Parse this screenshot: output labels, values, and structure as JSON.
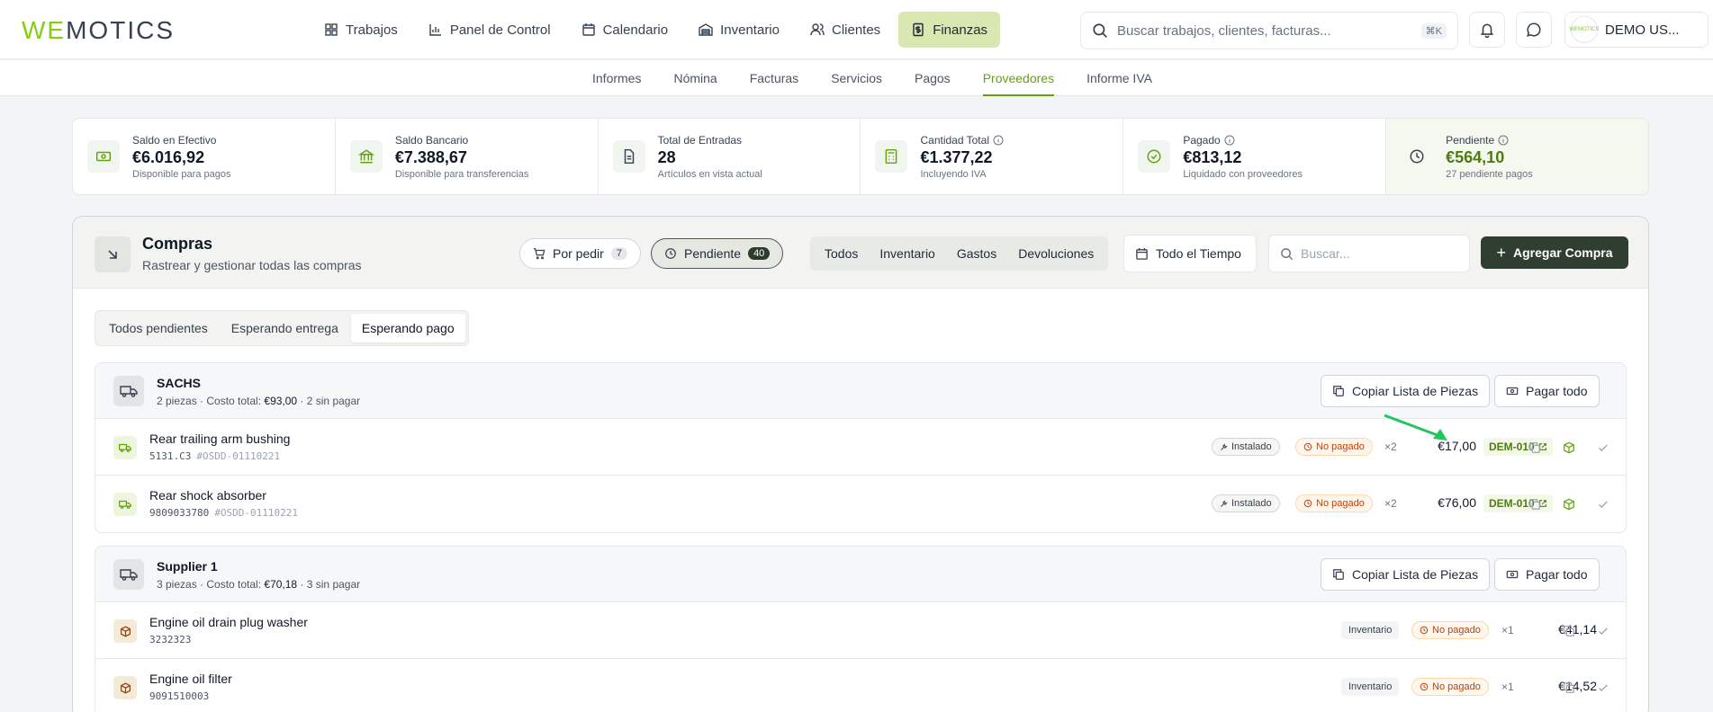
{
  "topbar": {
    "logo_a": "WE",
    "logo_b": "MOTICS",
    "nav": [
      {
        "label": "Trabajos",
        "icon": "grid-icon"
      },
      {
        "label": "Panel de Control",
        "icon": "bar-chart-icon"
      },
      {
        "label": "Calendario",
        "icon": "calendar-icon"
      },
      {
        "label": "Inventario",
        "icon": "warehouse-icon"
      },
      {
        "label": "Clientes",
        "icon": "users-icon"
      },
      {
        "label": "Finanzas",
        "icon": "dollar-file-icon",
        "active": true
      }
    ],
    "search_placeholder": "Buscar trabajos, clientes, facturas...",
    "search_shortcut": "⌘K",
    "avatar_text": "WEMOTICS",
    "user_label": "DEMO US..."
  },
  "subnav": [
    "Informes",
    "Nómina",
    "Facturas",
    "Servicios",
    "Pagos",
    "Proveedores",
    "Informe IVA"
  ],
  "subnav_active": "Proveedores",
  "stats": [
    {
      "label": "Saldo en Efectivo",
      "value": "€6.016,92",
      "sub": "Disponible para pagos",
      "info": false
    },
    {
      "label": "Saldo Bancario",
      "value": "€7.388,67",
      "sub": "Disponible para transferencias",
      "info": false
    },
    {
      "label": "Total de Entradas",
      "value": "28",
      "sub": "Artículos en vista actual",
      "info": false
    },
    {
      "label": "Cantidad Total",
      "value": "€1.377,22",
      "sub": "Incluyendo IVA",
      "info": true
    },
    {
      "label": "Pagado",
      "value": "€813,12",
      "sub": "Liquidado con proveedores",
      "info": true
    },
    {
      "label": "Pendiente",
      "value": "€564,10",
      "sub": "27 pendiente pagos",
      "info": true
    }
  ],
  "panel": {
    "title": "Compras",
    "subtitle": "Rastrear y gestionar todas las compras",
    "pill_order": {
      "label": "Por pedir",
      "count": "7"
    },
    "pill_pending": {
      "label": "Pendiente",
      "count": "40"
    },
    "segments": [
      "Todos",
      "Inventario",
      "Gastos",
      "Devoluciones"
    ],
    "time_label": "Todo el Tiempo",
    "search_placeholder": "Buscar...",
    "add_label": "Agregar Compra",
    "subtabs": [
      "Todos pendientes",
      "Esperando entrega",
      "Esperando pago"
    ],
    "subtab_active": "Esperando pago",
    "copy_label": "Copiar Lista de Piezas",
    "pay_label": "Pagar todo"
  },
  "groups": [
    {
      "name": "SACHS",
      "meta_a": "2 piezas · Costo total: ",
      "meta_total": "€93,00",
      "meta_b": " · 2 sin pagar",
      "rows": [
        {
          "name": "Rear trailing arm bushing",
          "code": "5131.C3",
          "ref": "#OSDD-01110221",
          "status": "Instalado",
          "payment": "No pagado",
          "qty": "×2",
          "price": "€17,00",
          "job": "DEM-010"
        },
        {
          "name": "Rear shock absorber",
          "code": "9809033780",
          "ref": "#OSDD-01110221",
          "status": "Instalado",
          "payment": "No pagado",
          "qty": "×2",
          "price": "€76,00",
          "job": "DEM-010"
        }
      ]
    },
    {
      "name": "Supplier 1",
      "meta_a": "3 piezas · Costo total: ",
      "meta_total": "€70,18",
      "meta_b": " · 3 sin pagar",
      "rows": [
        {
          "name": "Engine oil drain plug washer",
          "code": "3232323",
          "status": "Inventario",
          "payment": "No pagado",
          "qty": "×1",
          "price": "€41,14"
        },
        {
          "name": "Engine oil filter",
          "code": "9091510003",
          "status": "Inventario",
          "payment": "No pagado",
          "qty": "×1",
          "price": "€14,52"
        }
      ]
    }
  ],
  "colors": {
    "brand": "#84cc16",
    "accent_dark": "#2f3e30",
    "unpaid": "#c2410c",
    "arrow": "#22c55e"
  }
}
